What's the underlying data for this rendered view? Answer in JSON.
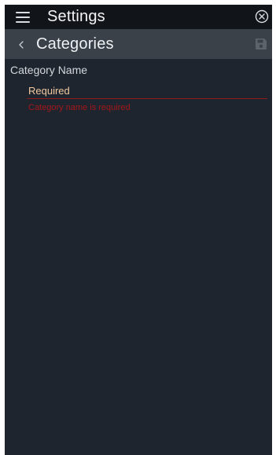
{
  "header": {
    "title": "Settings",
    "menu_icon": "hamburger-menu-icon",
    "close_icon": "circle-close-icon"
  },
  "subheader": {
    "title": "Categories",
    "back_icon": "chevron-left-icon",
    "save_icon": "floppy-disk-icon"
  },
  "form": {
    "category_name": {
      "label": "Category Name",
      "value": "",
      "placeholder": "Required",
      "error": "Category name is required"
    }
  },
  "colors": {
    "page_bg": "#1f252e",
    "topbar_bg": "#111418",
    "subbar_bg": "#3b4148",
    "placeholder": "#f0c9a0",
    "error": "#a3171a"
  }
}
